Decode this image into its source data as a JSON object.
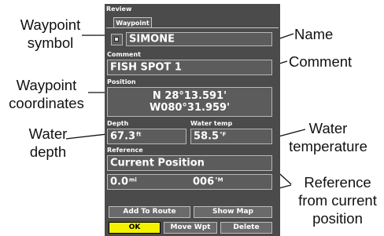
{
  "device": {
    "title": "Review",
    "tab": "Waypoint",
    "name": "SIMONE",
    "comment_label": "Comment",
    "comment": "FISH SPOT 1",
    "position_label": "Position",
    "lat": "N 28°13.591'",
    "lon": "W080°31.959'",
    "depth_label": "Depth",
    "depth": "67.3",
    "depth_unit": "ft",
    "temp_label": "Water temp",
    "temp": "58.5",
    "temp_unit": "°F",
    "reference_label": "Reference",
    "reference": "Current Position",
    "distance": "0.0",
    "distance_unit": "mi",
    "bearing": "006",
    "bearing_unit": "°M",
    "buttons": {
      "add_to_route": "Add To Route",
      "show_map": "Show Map",
      "ok": "OK",
      "move_wpt": "Move Wpt",
      "delete": "Delete"
    }
  },
  "callouts": {
    "waypoint_symbol": [
      "Waypoint",
      "symbol"
    ],
    "waypoint_coordinates": [
      "Waypoint",
      "coordinates"
    ],
    "water_depth": [
      "Water",
      "depth"
    ],
    "name": "Name",
    "comment": "Comment",
    "water_temperature": [
      "Water",
      "temperature"
    ],
    "reference": [
      "Reference",
      "from current",
      "position"
    ]
  },
  "colors": {
    "screen_bg": "#4b4b4b",
    "ok_button": "#f2f200",
    "field_border": "#b8b8b8"
  }
}
